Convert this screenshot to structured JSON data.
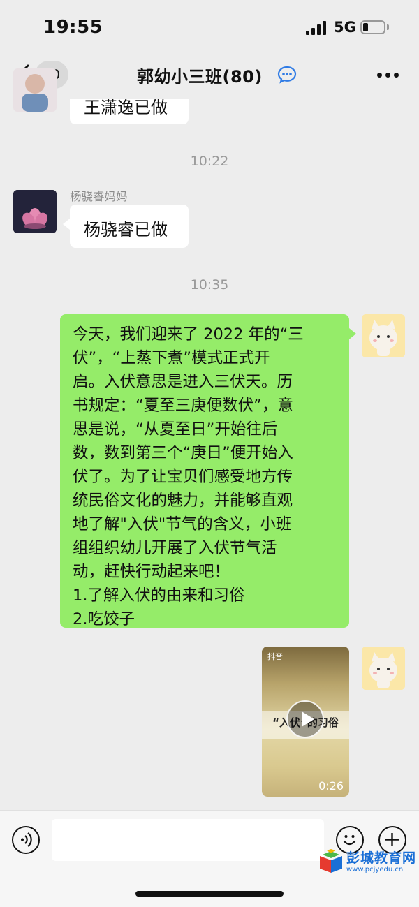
{
  "status_bar": {
    "time": "19:55",
    "network": "5G",
    "battery_level": 0.25
  },
  "nav": {
    "back_count": "20",
    "title": "郭幼小三班(80)"
  },
  "messages": [
    {
      "type": "incoming",
      "text": "王潇逸已做"
    },
    {
      "type": "timestamp",
      "text": "10:22"
    },
    {
      "type": "incoming",
      "sender": "杨骁睿妈妈",
      "text": "杨骁睿已做"
    },
    {
      "type": "timestamp",
      "text": "10:35"
    },
    {
      "type": "outgoing",
      "lines": [
        "今天，我们迎来了 2022 年的“三",
        "伏”，“上蒸下煮”模式正式开",
        "启。入伏意思是进入三伏天。历",
        "书规定：“夏至三庚便数伏”，意",
        "思是说，“从夏至日”开始往后",
        "数，数到第三个“庚日”便开始入",
        "伏了。为了让宝贝们感受地方传",
        "统民俗文化的魅力，并能够直观",
        "地了解\"入伏\"节气的含义，小班",
        "组组织幼儿开展了入伏节气活",
        "动，赶快行动起来吧！",
        "1.了解入伏的由来和习俗",
        "2.吃饺子"
      ]
    },
    {
      "type": "video",
      "source": "抖音",
      "caption": "“入伏”的习俗",
      "duration": "0:26"
    }
  ],
  "watermark": {
    "title": "彭城教育网",
    "url": "www.pcjyedu.cn"
  },
  "colors": {
    "background": "#ededed",
    "outgoing_bubble": "#95ec69",
    "incoming_bubble": "#ffffff"
  }
}
